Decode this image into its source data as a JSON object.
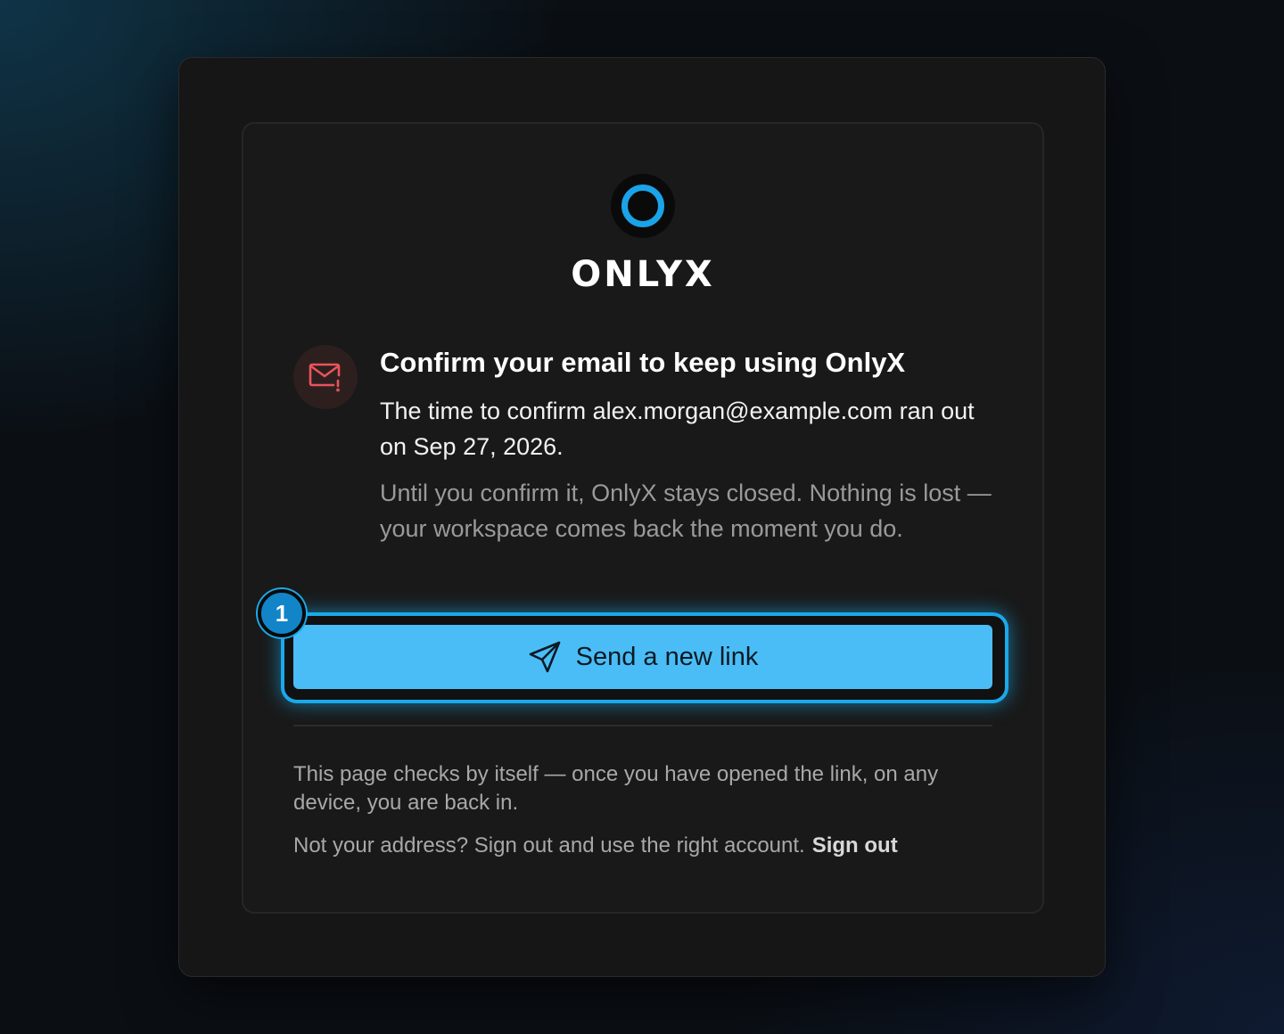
{
  "brand": {
    "name": "ONLYX",
    "accent": "#1aa3e8"
  },
  "notice": {
    "icon": "mail-alert-icon",
    "title": "Confirm your email to keep using OnlyX",
    "lead": "The time to confirm alex.morgan@example.com ran out on Sep 27, 2026.",
    "sub": "Until you confirm it, OnlyX stays closed. Nothing is lost — your workspace comes back the moment you do."
  },
  "action": {
    "badge": "1",
    "icon": "send-icon",
    "label": "Send a new link",
    "color": "#4bbdf6"
  },
  "footer": {
    "auto_check": "This page checks by itself — once you have opened the link, on any device, you are back in.",
    "wrong_address": "Not your address? Sign out and use the right account.",
    "signout_label": "Sign out"
  }
}
